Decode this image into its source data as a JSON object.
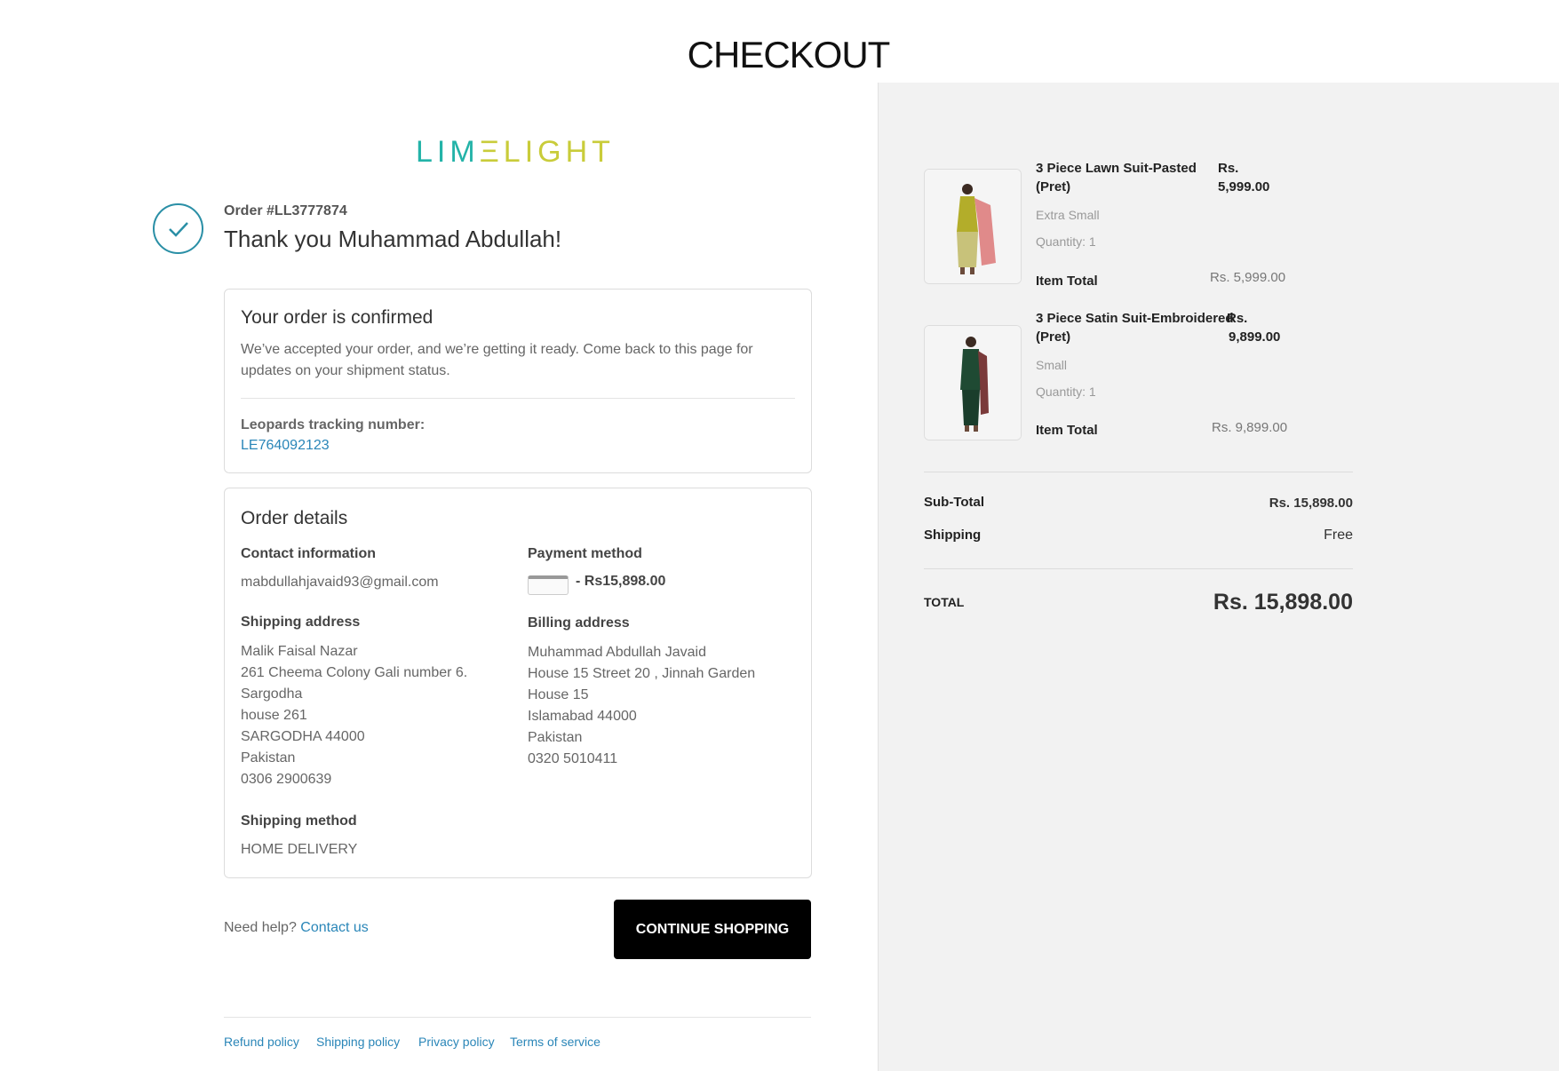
{
  "header": {
    "title": "CHECKOUT"
  },
  "brand": {
    "logo_part1": "LIM",
    "logo_part2": "ΞLIGHT",
    "colors": {
      "teal": "#23b3a8",
      "lime": "#c9cc3a"
    }
  },
  "order": {
    "number": "Order #LL3777874",
    "thanks": "Thank you Muhammad Abdullah!"
  },
  "confirmation": {
    "title": "Your order is confirmed",
    "message": "We’ve accepted your order, and we’re getting it ready. Come back to this page for updates on your shipment status.",
    "tracking_label": "Leopards tracking number:",
    "tracking_number": "LE764092123"
  },
  "details": {
    "title": "Order details",
    "contact_label": "Contact information",
    "contact_email": "mabdullahjavaid93@gmail.com",
    "payment_label": "Payment method",
    "payment_value": "- Rs15,898.00",
    "shipping_address_label": "Shipping address",
    "shipping_address": [
      "Malik Faisal Nazar",
      "261 Cheema Colony Gali number 6.",
      "Sargodha",
      "house 261",
      "SARGODHA 44000",
      "Pakistan",
      "0306 2900639"
    ],
    "billing_address_label": "Billing address",
    "billing_address": [
      "Muhammad Abdullah Javaid",
      "House 15 Street 20 , Jinnah Garden",
      "House 15",
      "Islamabad 44000",
      "Pakistan",
      "0320 5010411"
    ],
    "shipping_method_label": "Shipping method",
    "shipping_method": "HOME DELIVERY"
  },
  "help": {
    "text": "Need help?",
    "link": "Contact us"
  },
  "continue_button": "CONTINUE SHOPPING",
  "footer_links": [
    "Refund policy",
    "Shipping policy",
    "Privacy policy",
    "Terms of service"
  ],
  "cart": {
    "items": [
      {
        "name_line1": "3 Piece Lawn Suit-Pasted",
        "name_line2": "(Pret)",
        "price_line1": "Rs.",
        "price_line2": "5,999.00",
        "size": "Extra Small",
        "quantity": "Quantity: 1",
        "total_label": "Item Total",
        "total_value": "Rs. 5,999.00"
      },
      {
        "name_line1": "3 Piece Satin Suit-Embroidered",
        "name_line2": "(Pret)",
        "price_line1": "Rs.",
        "price_line2": "9,899.00",
        "size": "Small",
        "quantity": "Quantity: 1",
        "total_label": "Item Total",
        "total_value": "Rs. 9,899.00"
      }
    ],
    "subtotal_label": "Sub-Total",
    "subtotal_value": "Rs. 15,898.00",
    "shipping_label": "Shipping",
    "shipping_value": "Free",
    "total_label": "TOTAL",
    "total_value": "Rs. 15,898.00"
  }
}
